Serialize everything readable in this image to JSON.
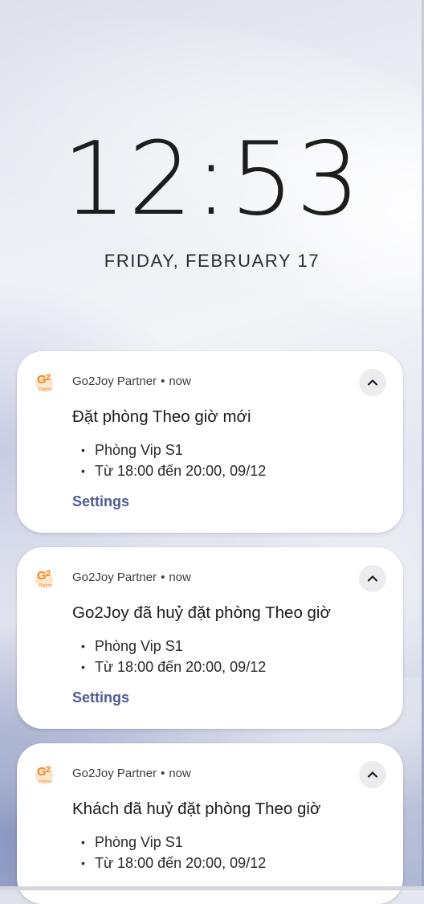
{
  "lockscreen": {
    "time": "12:53",
    "date": "FRIDAY, FEBRUARY 17"
  },
  "notifications": [
    {
      "app_name": "Go2Joy Partner",
      "separator": "•",
      "timestamp": "now",
      "title": "Đặt phòng Theo giờ mới",
      "lines": [
        "Phòng Vip S1",
        "Từ 18:00 đến 20:00, 09/12"
      ],
      "action_label": "Settings",
      "icon": "go2joy-partner-logo",
      "expand_icon": "chevron-up-icon"
    },
    {
      "app_name": "Go2Joy Partner",
      "separator": "•",
      "timestamp": "now",
      "title": "Go2Joy đã huỷ đặt phòng Theo giờ",
      "lines": [
        "Phòng Vip S1",
        "Từ 18:00 đến 20:00, 09/12"
      ],
      "action_label": "Settings",
      "icon": "go2joy-partner-logo",
      "expand_icon": "chevron-up-icon"
    },
    {
      "app_name": "Go2Joy Partner",
      "separator": "•",
      "timestamp": "now",
      "title": "Khách đã huỷ đặt phòng Theo giờ",
      "lines": [
        "Phòng Vip S1",
        "Từ 18:00 đến 20:00, 09/12"
      ],
      "icon": "go2joy-partner-logo",
      "expand_icon": "chevron-up-icon"
    }
  ],
  "colors": {
    "brand_orange": "#f08a24",
    "action_text": "#4f5b93",
    "card_background": "#ffffff"
  },
  "logo_text": {
    "mark": "G2",
    "sub": "Partner"
  }
}
